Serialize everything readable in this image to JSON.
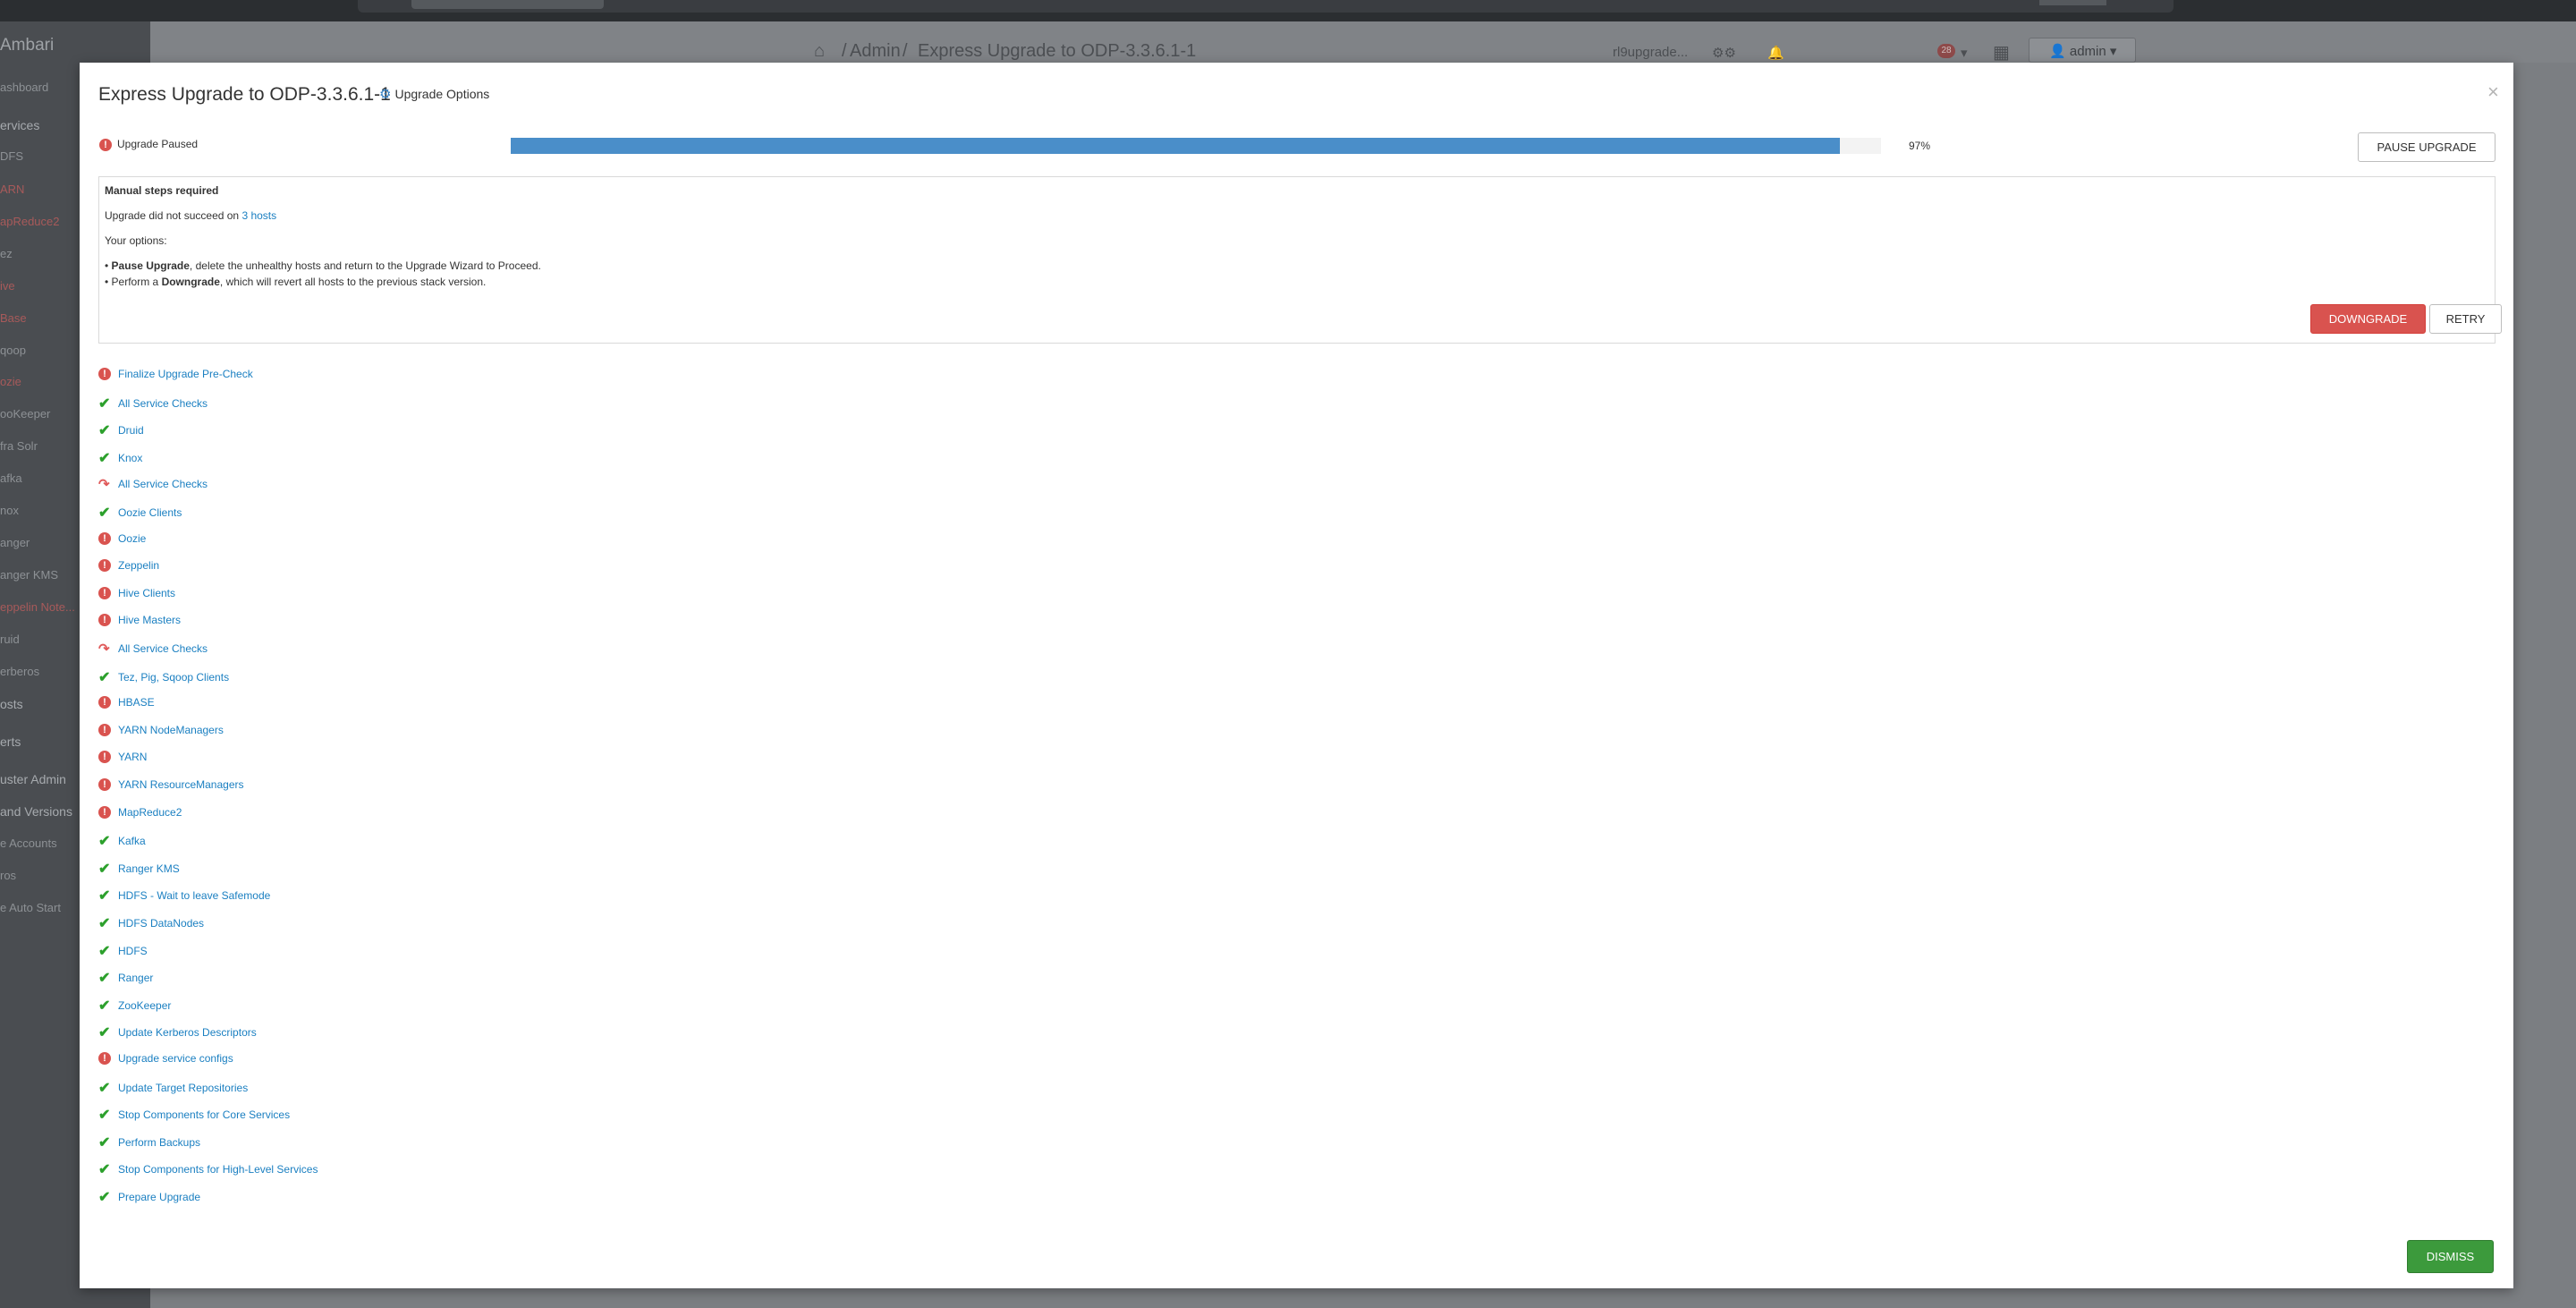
{
  "sidebar": {
    "brand": "Ambari",
    "items": [
      {
        "label": "ashboard",
        "state": "normal"
      },
      {
        "label": "ervices",
        "state": "strong"
      },
      {
        "label": "DFS",
        "state": "normal"
      },
      {
        "label": "ARN",
        "state": "alert"
      },
      {
        "label": "apReduce2",
        "state": "alert"
      },
      {
        "label": "ez",
        "state": "normal"
      },
      {
        "label": "ive",
        "state": "alert"
      },
      {
        "label": "Base",
        "state": "alert"
      },
      {
        "label": "qoop",
        "state": "normal"
      },
      {
        "label": "ozie",
        "state": "alert"
      },
      {
        "label": "ooKeeper",
        "state": "normal"
      },
      {
        "label": "fra Solr",
        "state": "normal"
      },
      {
        "label": "afka",
        "state": "normal"
      },
      {
        "label": "nox",
        "state": "normal"
      },
      {
        "label": "anger",
        "state": "normal"
      },
      {
        "label": "anger KMS",
        "state": "normal"
      },
      {
        "label": "eppelin Note...",
        "state": "alert"
      },
      {
        "label": "ruid",
        "state": "normal"
      },
      {
        "label": "erberos",
        "state": "normal"
      },
      {
        "label": "osts",
        "state": "strong"
      },
      {
        "label": "erts",
        "state": "strong"
      },
      {
        "label": "uster Admin",
        "state": "strong"
      },
      {
        "label": " and Versions",
        "state": "strong"
      },
      {
        "label": "e Accounts",
        "state": "normal"
      },
      {
        "label": "ros",
        "state": "normal"
      },
      {
        "label": "e Auto Start",
        "state": "normal"
      }
    ]
  },
  "header": {
    "breadcrumb_admin": "Admin",
    "breadcrumb_page": "Express Upgrade to ODP-3.3.6.1-1",
    "cluster_name": "rl9upgrade...",
    "alerts_count": "28",
    "user": "admin"
  },
  "modal": {
    "title": "Express Upgrade to ODP-3.3.6.1-1",
    "options_label": "Upgrade Options",
    "close_label": "×",
    "status_label": "Upgrade Paused",
    "progress_percent": 97,
    "progress_label": "97%",
    "pause_button": "PAUSE UPGRADE",
    "manual": {
      "title": "Manual steps required",
      "failed_prefix": "Upgrade did not succeed on",
      "failed_hosts_link": "3 hosts",
      "options_heading": "Your options:",
      "bullet1_strong": "Pause Upgrade",
      "bullet1_rest": ", delete the unhealthy hosts and return to the Upgrade Wizard to Proceed.",
      "bullet2_prefix": "Perform a ",
      "bullet2_strong": "Downgrade",
      "bullet2_rest": ", which will revert all hosts to the previous stack version."
    },
    "downgrade_button": "DOWNGRADE",
    "retry_button": "RETRY",
    "dismiss_button": "DISMISS",
    "groups": [
      {
        "label": "Finalize Upgrade Pre-Check",
        "status": "failed"
      },
      {
        "label": "All Service Checks",
        "status": "completed"
      },
      {
        "label": "Druid",
        "status": "completed"
      },
      {
        "label": "Knox",
        "status": "completed"
      },
      {
        "label": "All Service Checks",
        "status": "skipped"
      },
      {
        "label": "Oozie Clients",
        "status": "completed"
      },
      {
        "label": "Oozie",
        "status": "failed"
      },
      {
        "label": "Zeppelin",
        "status": "failed"
      },
      {
        "label": "Hive Clients",
        "status": "failed"
      },
      {
        "label": "Hive Masters",
        "status": "failed"
      },
      {
        "label": "All Service Checks",
        "status": "skipped"
      },
      {
        "label": "Tez, Pig, Sqoop Clients",
        "status": "completed"
      },
      {
        "label": "HBASE",
        "status": "failed"
      },
      {
        "label": "YARN NodeManagers",
        "status": "failed"
      },
      {
        "label": "YARN",
        "status": "failed"
      },
      {
        "label": "YARN ResourceManagers",
        "status": "failed"
      },
      {
        "label": "MapReduce2",
        "status": "failed"
      },
      {
        "label": "Kafka",
        "status": "completed"
      },
      {
        "label": "Ranger KMS",
        "status": "completed"
      },
      {
        "label": "HDFS - Wait to leave Safemode",
        "status": "completed"
      },
      {
        "label": "HDFS DataNodes",
        "status": "completed"
      },
      {
        "label": "HDFS",
        "status": "completed"
      },
      {
        "label": "Ranger",
        "status": "completed"
      },
      {
        "label": "ZooKeeper",
        "status": "completed"
      },
      {
        "label": "Update Kerberos Descriptors",
        "status": "completed"
      },
      {
        "label": "Upgrade service configs",
        "status": "failed"
      },
      {
        "label": "Update Target Repositories",
        "status": "completed"
      },
      {
        "label": "Stop Components for Core Services",
        "status": "completed"
      },
      {
        "label": "Perform Backups",
        "status": "completed"
      },
      {
        "label": "Stop Components for High-Level Services",
        "status": "completed"
      },
      {
        "label": "Prepare Upgrade",
        "status": "completed"
      }
    ]
  },
  "colors": {
    "link": "#1a7fc1",
    "success": "#2ca02c",
    "danger": "#d9534f",
    "progress": "#4a8ec9",
    "dismiss": "#3c9a3c"
  }
}
